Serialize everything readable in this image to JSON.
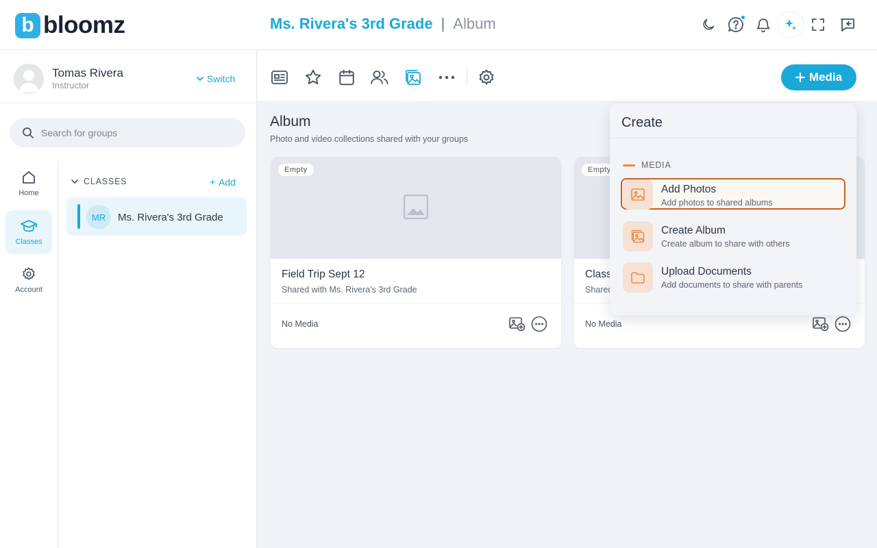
{
  "app": {
    "logo_letter": "b",
    "logo_text": "bloomz"
  },
  "header": {
    "group_name": "Ms. Rivera's 3rd Grade",
    "separator": "|",
    "section": "Album",
    "icons": [
      "moon-icon",
      "help-icon",
      "bell-icon",
      "ai-sparkle-icon",
      "fullscreen-icon",
      "messages-icon"
    ]
  },
  "user": {
    "name": "Tomas Rivera",
    "role": "Instructor",
    "switch_label": "Switch"
  },
  "search": {
    "placeholder": "Search for groups"
  },
  "rail": [
    {
      "label": "Home",
      "icon": "home-icon",
      "active": false
    },
    {
      "label": "Classes",
      "icon": "graduation-cap-icon",
      "active": true
    },
    {
      "label": "Account",
      "icon": "gear-icon",
      "active": false
    }
  ],
  "classes": {
    "heading": "CLASSES",
    "add_label": "Add",
    "items": [
      {
        "initials": "MR",
        "name": "Ms. Rivera's 3rd Grade"
      }
    ]
  },
  "toolbar": {
    "tools": [
      "newsfeed-icon",
      "star-icon",
      "calendar-icon",
      "people-icon",
      "album-icon",
      "more-icon",
      "settings-icon"
    ],
    "active_tool": "album-icon",
    "media_button": "Media"
  },
  "main": {
    "title": "Album",
    "subtitle": "Photo and video collections shared with your groups",
    "albums": [
      {
        "badge": "Empty",
        "title": "Field Trip Sept 12",
        "shared": "Shared with Ms. Rivera's 3rd Grade",
        "media": "No Media"
      },
      {
        "badge": "Empty",
        "title": "Class",
        "shared": "Shared",
        "media": "No Media"
      }
    ]
  },
  "dropdown": {
    "title": "Create",
    "section": "MEDIA",
    "items": [
      {
        "label": "Add Photos",
        "desc": "Add photos to shared albums",
        "icon": "image-icon",
        "highlighted": true
      },
      {
        "label": "Create Album",
        "desc": "Create album to share with others",
        "icon": "album-icon",
        "highlighted": false
      },
      {
        "label": "Upload Documents",
        "desc": "Add documents to share with parents",
        "icon": "folder-icon",
        "highlighted": false
      }
    ]
  },
  "colors": {
    "accent": "#1aa8d8",
    "orange": "#f0883e",
    "highlight_border": "#c9611e"
  }
}
